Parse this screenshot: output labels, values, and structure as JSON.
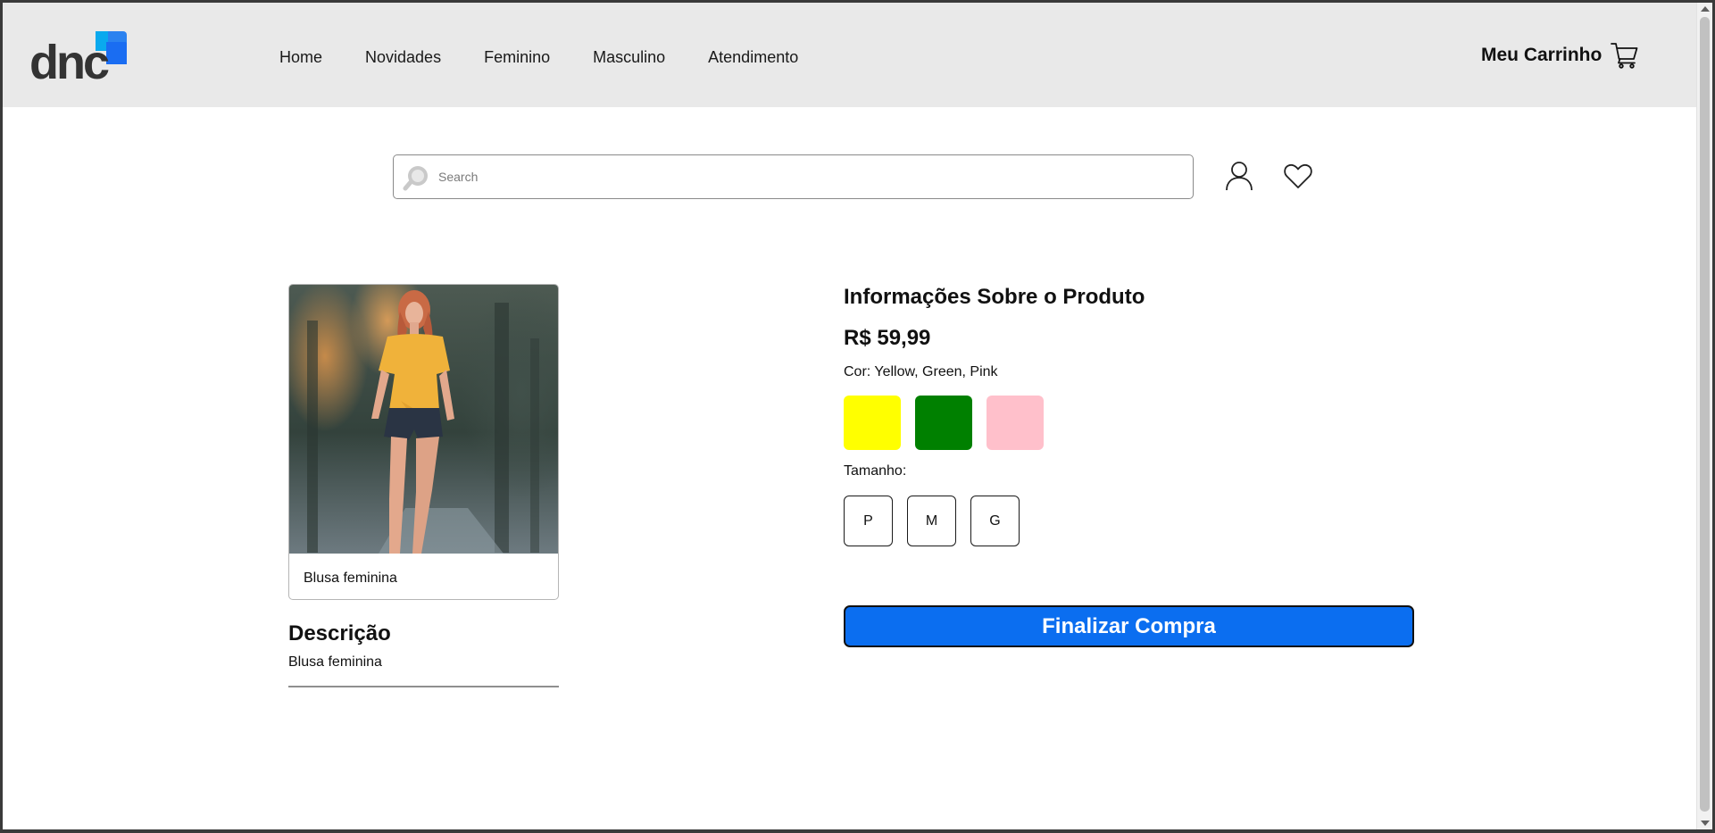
{
  "header": {
    "logo_text": "dnc",
    "nav": [
      "Home",
      "Novidades",
      "Feminino",
      "Masculino",
      "Atendimento"
    ],
    "cart_label": "Meu Carrinho"
  },
  "search": {
    "placeholder": "Search"
  },
  "product": {
    "caption": "Blusa feminina",
    "description_title": "Descrição",
    "description_text": "Blusa feminina"
  },
  "info": {
    "title": "Informações Sobre o Produto",
    "price": "R$ 59,99",
    "color_label": "Cor: Yellow, Green, Pink",
    "colors": [
      {
        "name": "Yellow",
        "hex": "#ffff00"
      },
      {
        "name": "Green",
        "hex": "#008000"
      },
      {
        "name": "Pink",
        "hex": "#ffc0cb"
      }
    ],
    "size_label": "Tamanho:",
    "sizes": [
      "P",
      "M",
      "G"
    ],
    "checkout_label": "Finalizar Compra"
  },
  "colors": {
    "header_bg": "#e9e9e9",
    "accent": "#0b6ef0"
  }
}
